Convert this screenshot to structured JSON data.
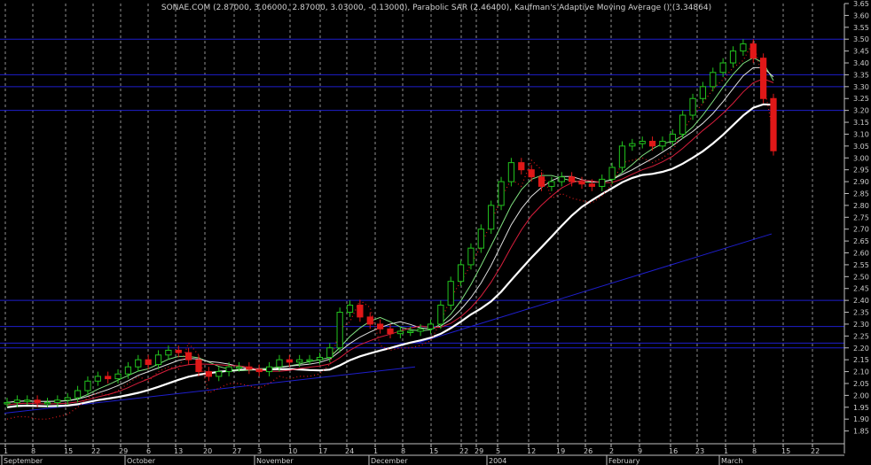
{
  "header": {
    "title": "SONAE.COM (2.87000, 3.06000, 2.87000, 3.03000, -0.13000), Parabolic SAR (2.46400), Kaufman's Adaptive Moving Average () (3.34864)"
  },
  "chart_data": {
    "type": "candlestick",
    "ylim": [
      1.8,
      3.65
    ],
    "y_ticks": [
      "3.65",
      "3.60",
      "3.55",
      "3.50",
      "3.45",
      "3.40",
      "3.35",
      "3.30",
      "3.25",
      "3.20",
      "3.15",
      "3.10",
      "3.05",
      "3.00",
      "2.95",
      "2.90",
      "2.85",
      "2.80",
      "2.75",
      "2.70",
      "2.65",
      "2.60",
      "2.55",
      "2.50",
      "2.45",
      "2.40",
      "2.35",
      "2.30",
      "2.25",
      "2.20",
      "2.15",
      "2.10",
      "2.05",
      "2.00",
      "1.95",
      "1.90",
      "1.85"
    ],
    "x_day_labels": [
      "1",
      "8",
      "15",
      "22",
      "29",
      "6",
      "13",
      "20",
      "27",
      "3",
      "10",
      "17",
      "24",
      "1",
      "8",
      "15",
      "22",
      "29",
      "5",
      "12",
      "19",
      "26",
      "2",
      "9",
      "16",
      "23",
      "1",
      "8",
      "15",
      "22"
    ],
    "month_labels": [
      "September",
      "October",
      "November",
      "December",
      "2004",
      "February",
      "March"
    ],
    "horizontal_lines": [
      3.5,
      3.35,
      3.3,
      3.2,
      2.4,
      2.29,
      2.22,
      2.2
    ],
    "grid": true,
    "colors": {
      "background": "#000000",
      "grid": "#bfbfbf",
      "up_candle": "#22c41e",
      "down_candle": "#e01818",
      "sar": "#e01818",
      "kama": "#ffffff",
      "hlines": "#1e1ecc",
      "trendline": "#1e1ecc"
    },
    "series": [
      {
        "name": "Close",
        "values": [
          1.97,
          1.98,
          1.98,
          1.97,
          1.97,
          1.98,
          1.99,
          2.02,
          2.06,
          2.08,
          2.07,
          2.09,
          2.12,
          2.15,
          2.13,
          2.17,
          2.19,
          2.18,
          2.15,
          2.1,
          2.08,
          2.1,
          2.12,
          2.12,
          2.11,
          2.1,
          2.12,
          2.15,
          2.14,
          2.15,
          2.15,
          2.16,
          2.2,
          2.35,
          2.38,
          2.33,
          2.3,
          2.28,
          2.26,
          2.27,
          2.27,
          2.28,
          2.3,
          2.38,
          2.48,
          2.55,
          2.62,
          2.7,
          2.8,
          2.9,
          2.98,
          2.95,
          2.92,
          2.88,
          2.9,
          2.92,
          2.9,
          2.89,
          2.88,
          2.91,
          2.96,
          3.05,
          3.06,
          3.07,
          3.05,
          3.07,
          3.1,
          3.18,
          3.25,
          3.3,
          3.36,
          3.4,
          3.45,
          3.48,
          3.42,
          3.25,
          3.03
        ]
      },
      {
        "name": "Parabolic SAR",
        "values": [
          2.46
        ]
      },
      {
        "name": "Kaufman's Adaptive Moving Average",
        "values": [
          3.35
        ]
      }
    ]
  }
}
